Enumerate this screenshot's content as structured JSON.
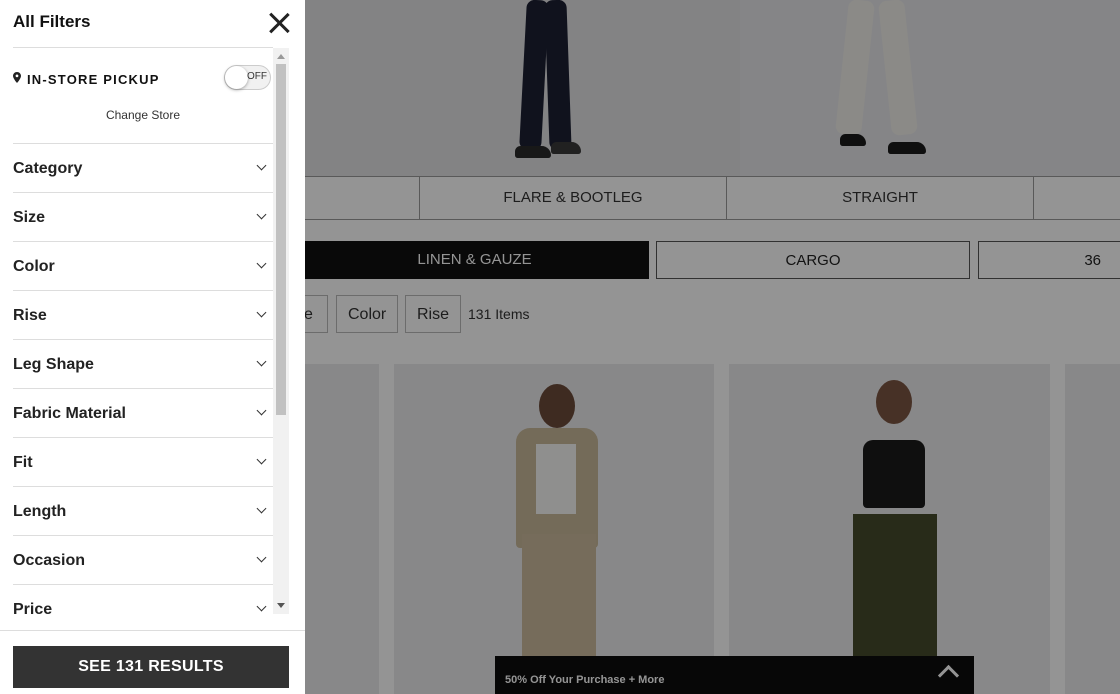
{
  "drawer": {
    "title": "All Filters",
    "pickup": {
      "label": "IN-STORE PICKUP",
      "toggle_state": "OFF",
      "change_store": "Change Store"
    },
    "facets": [
      {
        "label": "Category"
      },
      {
        "label": "Size"
      },
      {
        "label": "Color"
      },
      {
        "label": "Rise"
      },
      {
        "label": "Leg Shape"
      },
      {
        "label": "Fabric Material"
      },
      {
        "label": "Fit"
      },
      {
        "label": "Length"
      },
      {
        "label": "Occasion"
      },
      {
        "label": "Price"
      }
    ],
    "results_button": "SEE 131 RESULTS"
  },
  "background": {
    "style_tabs": [
      "FLARE & BOOTLEG",
      "STRAIGHT"
    ],
    "fabric_pills": [
      "LINEN & GAUZE",
      "CARGO",
      "36"
    ],
    "filter_chips": [
      "ze",
      "Color",
      "Rise"
    ],
    "item_count": "131 Items",
    "promo_text": "50% Off Your Purchase + More"
  },
  "colors": {
    "results_button_bg": "#333333",
    "dark_pill_bg": "#111111",
    "overlay": "rgba(0,0,0,0.42)"
  }
}
